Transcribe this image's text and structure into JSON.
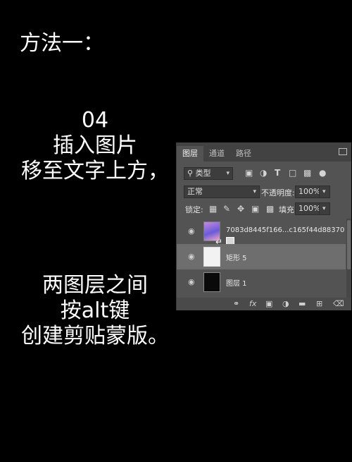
{
  "caption": {
    "title": "方法一：",
    "step_lines": [
      "04",
      "插入图片",
      "移至文字上方，"
    ],
    "note_lines": [
      "两图层之间",
      "按alt键",
      "创建剪贴蒙版。"
    ]
  },
  "panel": {
    "tabs": [
      "图层",
      "通道",
      "路径"
    ],
    "filter_label": "类型",
    "blend_mode": "正常",
    "opacity_label": "不透明度:",
    "opacity_value": "100%",
    "lock_label": "锁定:",
    "fill_label": "填充:",
    "fill_value": "100%",
    "layers": [
      {
        "name": "7083d8445f166...c165f44d88370"
      },
      {
        "name": "矩形 5"
      },
      {
        "name": "图层 1"
      }
    ],
    "bottom_icons": [
      "link-icon",
      "fx-icon",
      "mask-icon",
      "adjustment-icon",
      "folder-icon",
      "new-layer-icon",
      "trash-icon"
    ],
    "fx_label": "fx"
  }
}
